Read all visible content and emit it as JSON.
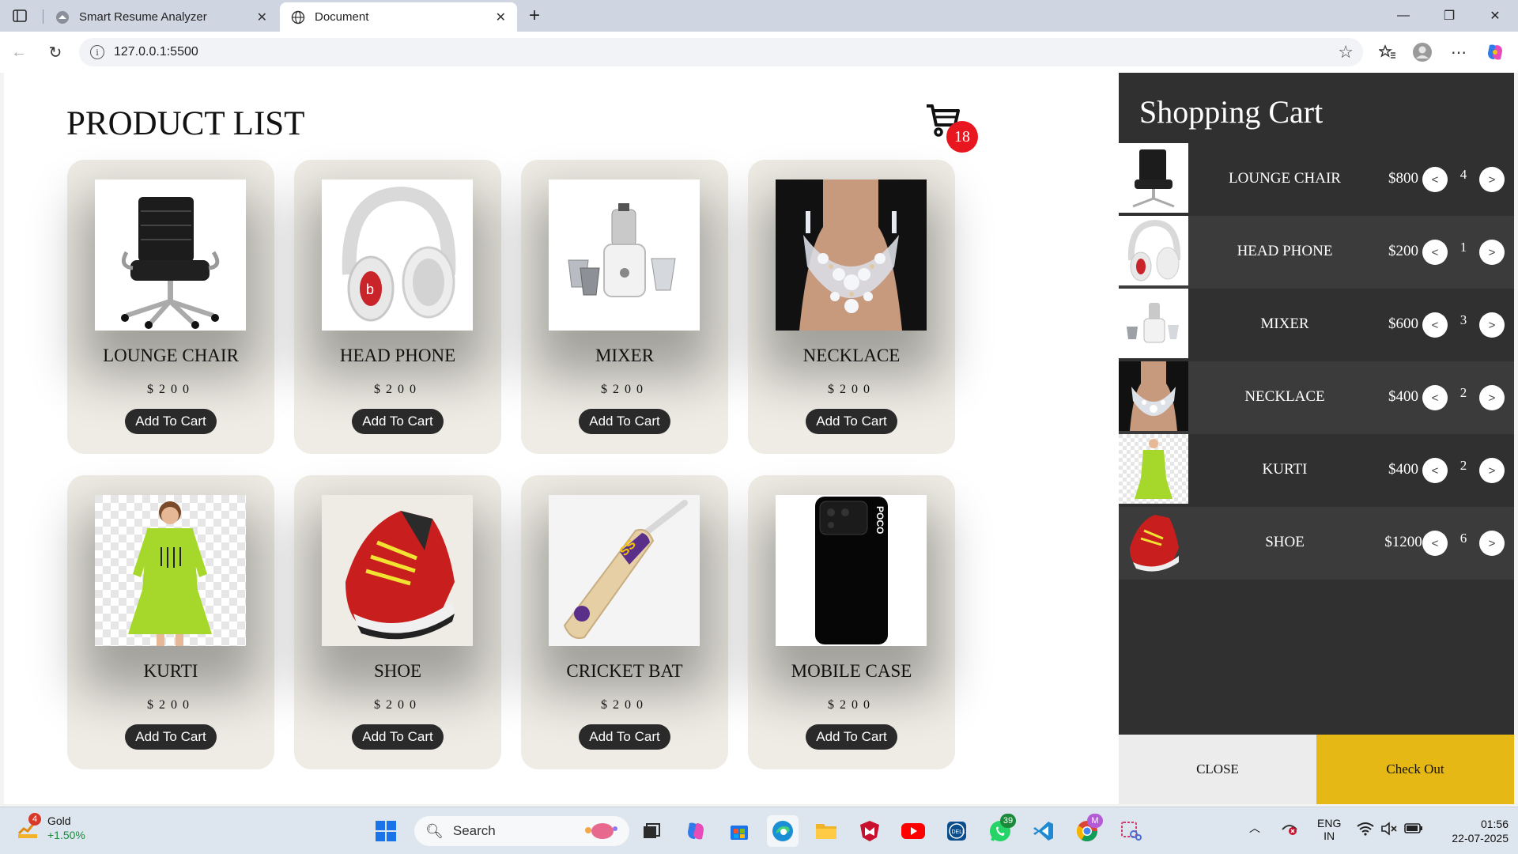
{
  "browser": {
    "tabs": [
      {
        "title": "Smart Resume Analyzer",
        "active": false
      },
      {
        "title": "Document",
        "active": true
      }
    ],
    "url": "127.0.0.1:5500"
  },
  "page": {
    "title": "PRODUCT LIST",
    "cart_count": "18",
    "products": [
      {
        "name": "LOUNGE CHAIR",
        "price": "$200",
        "button": "Add To Cart"
      },
      {
        "name": "HEAD PHONE",
        "price": "$200",
        "button": "Add To Cart"
      },
      {
        "name": "MIXER",
        "price": "$200",
        "button": "Add To Cart"
      },
      {
        "name": "NECKLACE",
        "price": "$200",
        "button": "Add To Cart"
      },
      {
        "name": "KURTI",
        "price": "$200",
        "button": "Add To Cart"
      },
      {
        "name": "SHOE",
        "price": "$200",
        "button": "Add To Cart"
      },
      {
        "name": "CRICKET BAT",
        "price": "$200",
        "button": "Add To Cart"
      },
      {
        "name": "MOBILE CASE",
        "price": "$200",
        "button": "Add To Cart"
      }
    ]
  },
  "cart": {
    "title": "Shopping Cart",
    "items": [
      {
        "name": "LOUNGE CHAIR",
        "price": "$800",
        "qty": "4",
        "minus": "<",
        "plus": ">"
      },
      {
        "name": "HEAD PHONE",
        "price": "$200",
        "qty": "1",
        "minus": "<",
        "plus": ">"
      },
      {
        "name": "MIXER",
        "price": "$600",
        "qty": "3",
        "minus": "<",
        "plus": ">"
      },
      {
        "name": "NECKLACE",
        "price": "$400",
        "qty": "2",
        "minus": "<",
        "plus": ">"
      },
      {
        "name": "KURTI",
        "price": "$400",
        "qty": "2",
        "minus": "<",
        "plus": ">"
      },
      {
        "name": "SHOE",
        "price": "$1200",
        "qty": "6",
        "minus": "<",
        "plus": ">"
      }
    ],
    "close_label": "CLOSE",
    "checkout_label": "Check Out"
  },
  "taskbar": {
    "weather_badge": "4",
    "weather_title": "Gold",
    "weather_change": "+1.50%",
    "search_placeholder": "Search",
    "whatsapp_badge": "39",
    "chrome_badge": "M",
    "lang_top": "ENG",
    "lang_bottom": "IN",
    "time": "01:56",
    "date": "22-07-2025"
  },
  "colors": {
    "cart_panel": "#303030",
    "checkout": "#e5b816",
    "badge": "#e8171f",
    "card": "#eeece4"
  }
}
